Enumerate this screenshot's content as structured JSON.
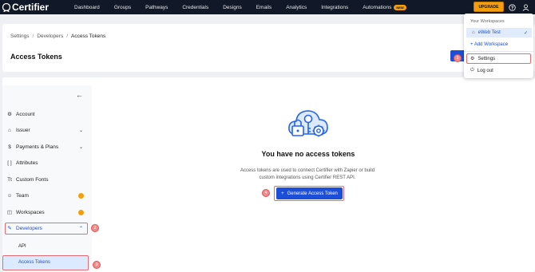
{
  "brand": {
    "name": "Certifier"
  },
  "nav": {
    "items": [
      "Dashboard",
      "Groups",
      "Pathways",
      "Credentials",
      "Designs",
      "Emails",
      "Analytics",
      "Integrations",
      "Automations"
    ],
    "automations_badge": "NEW",
    "upgrade_label": "UPGRADE"
  },
  "breadcrumb": {
    "items": [
      "Settings",
      "Developers",
      "Access Tokens"
    ],
    "separator": "/"
  },
  "page_title": "Access Tokens",
  "sidebar": {
    "items": [
      {
        "label": "Account",
        "icon": "gear-icon"
      },
      {
        "label": "Issuer",
        "icon": "bank-icon"
      },
      {
        "label": "Payments & Plans",
        "icon": "dollar-icon"
      },
      {
        "label": "Attributes",
        "icon": "brackets-icon"
      },
      {
        "label": "Custom Fonts",
        "icon": "text-icon"
      },
      {
        "label": "Team",
        "icon": "team-icon"
      },
      {
        "label": "Workspaces",
        "icon": "workspace-icon"
      },
      {
        "label": "Developers",
        "icon": "pen-icon"
      }
    ],
    "sub_items": [
      "API",
      "Access Tokens"
    ]
  },
  "empty_state": {
    "title": "You have no access tokens",
    "description": "Access tokens are used to connect Certifier with Zapier or build custom integrations using Certifier REST API.",
    "button_label": "Generate Access Token",
    "button_icon": "+"
  },
  "dropdown": {
    "header": "Your Workspaces",
    "workspace": "eWeb Test",
    "add_workspace": "+ Add Workspace",
    "settings": "Settings",
    "logout": "Log out"
  },
  "steps": [
    "1",
    "2",
    "3",
    "4"
  ],
  "colors": {
    "accent": "#1d4ed8",
    "upgrade": "#f59e0b",
    "highlight": "#e26d74",
    "nav_bg": "#111827"
  }
}
